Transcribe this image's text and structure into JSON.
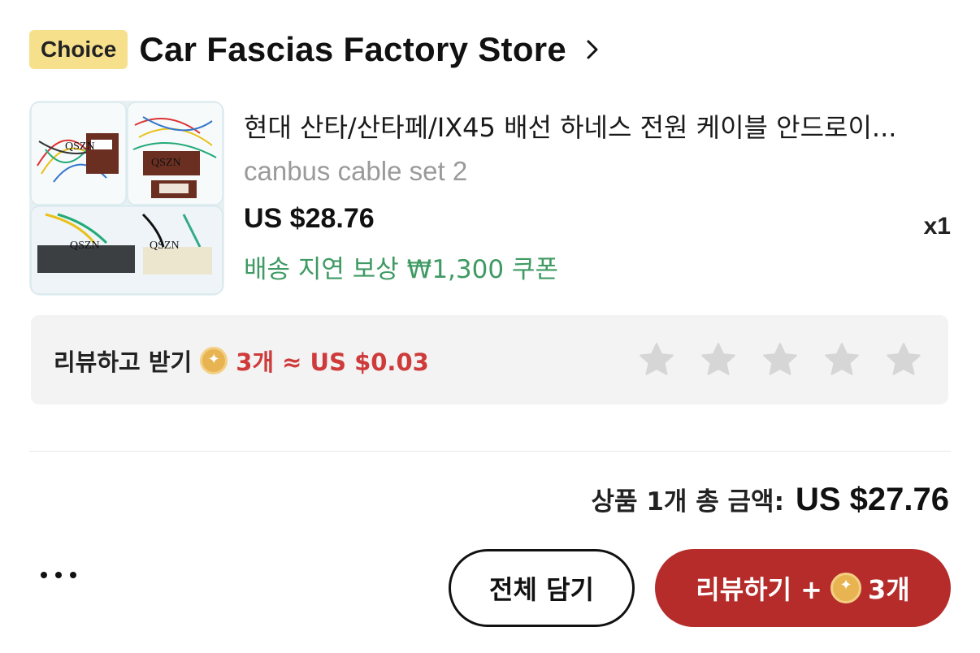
{
  "store": {
    "badge": "Choice",
    "name": "Car Fascias Factory Store",
    "chevron_icon": "chevron-right-icon"
  },
  "product": {
    "title": "현대 산타/산타페/IX45 배선 하네스 전원 케이블 안드로이...",
    "variant": "canbus cable set 2",
    "price": "US $28.76",
    "quantity": "x1",
    "coupon": "배송 지연 보상 ₩1,300 쿠폰",
    "thumbnail_watermarks": [
      "QSZN",
      "QSZN",
      "QSZN",
      "QSZN"
    ]
  },
  "review": {
    "label": "리뷰하고 받기",
    "reward": "3개 ≈ US $0.03",
    "coin_icon": "coin-icon",
    "stars_total": 5,
    "stars_selected": 0
  },
  "summary": {
    "label": "상품 1개 총 금액:",
    "amount": "US $27.76"
  },
  "actions": {
    "more_icon": "more-dots-icon",
    "add_all_label": "전체 담기",
    "review_label": "리뷰하기 +",
    "review_count": "3개"
  },
  "colors": {
    "choice_badge": "#f7e08c",
    "coupon_green": "#3f9a63",
    "reward_red": "#cf3a3a",
    "primary_button": "#b52c2a",
    "star_gray": "#d6d6d6"
  }
}
